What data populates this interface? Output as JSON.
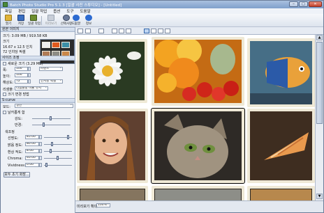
{
  "window": {
    "title": "Batch Photo Studio Pro 5.1.3 [일괄 사진 스튜디오] - [Untitled]",
    "minimize": "‒",
    "maximize": "□",
    "close": "✕"
  },
  "menu": [
    "파일",
    "편집",
    "일괄 작업",
    "옵션",
    "도구",
    "도움말"
  ],
  "toolbar": {
    "buttons": [
      {
        "label": "열기",
        "icon": "open-folder-icon",
        "color": "#e0b338"
      },
      {
        "label": "저장",
        "icon": "save-disk-icon",
        "color": "#3a6fc2"
      },
      {
        "label": "일괄 작업",
        "icon": "batch-icon",
        "color": "#6d8e2f"
      },
      {
        "label": "미리보기",
        "icon": "preview-icon",
        "color": "#9aa5b3"
      },
      {
        "label": "선택사항",
        "icon": "tools-icon",
        "color": "#6a7a99"
      },
      {
        "label": "도움말",
        "icon": "help-icon",
        "color": "#2d6bd1"
      },
      {
        "label": "정보",
        "icon": "info-icon",
        "color": "#2d6bd1"
      }
    ]
  },
  "sidebar": {
    "source_header": "원본 이미지",
    "source_size": "크기: 3.09 MB / 919.58 KB",
    "resolution": "16.67 x 12.5 인치",
    "dpi": "72 인치당 픽셀",
    "resize_header": "사이즈 조정",
    "resize_check": "새로운 크기 (3.29 MB)",
    "width_label": "폭:",
    "width_value": "100",
    "height_label": "높이:",
    "height_value": "100",
    "resolution_label": "해상도:",
    "resolution_value": "72",
    "unit_percent": "퍼센트",
    "unit_dpi": "인치당 픽셀",
    "method_label": "리샘플:",
    "method_value": "리샘플링 비율 유지",
    "keep_ratio": "크기 변경 방법",
    "filter_label": "S-curve",
    "filter_value": "필터",
    "mode_label": "모드:",
    "mode_value": "일반",
    "check_label": "날카롭게 함",
    "slider1_label": "강도:",
    "slider2_label": "반경:",
    "adjust_header": "색조정",
    "brightness_label": "선명도:",
    "brightness_value": "85.00",
    "contrast_label": "밝음 정도:",
    "contrast_value": "80.00",
    "hue_label": "환상 적도:",
    "hue_value": "8.00",
    "chroma_label": "Chroma:",
    "chroma_value": "40.00",
    "vividness_label": "Vividness:",
    "vividness_value": "0.00",
    "reset_button": "모두 초기 화장..."
  },
  "view": {
    "modes": [
      "grid-view",
      "compare-view",
      "single-view",
      "list-view"
    ]
  },
  "status": {
    "zoom_label": "미리보기 확대:",
    "zoom_value": "100%"
  }
}
